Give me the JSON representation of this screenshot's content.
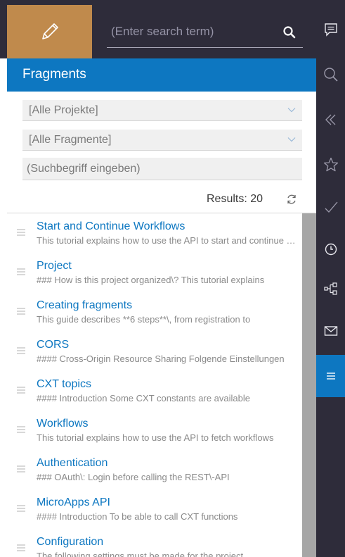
{
  "search": {
    "placeholder": "(Enter search term)"
  },
  "panel": {
    "title": "Fragments",
    "project_select": "[Alle Projekte]",
    "fragment_select": "[Alle Fragmente]",
    "search_placeholder": "(Suchbegriff eingeben)",
    "results_label": "Results: 20"
  },
  "list": [
    {
      "title": "Start and Continue Workflows",
      "desc": "This tutorial explains how to use the API to start and continue workflows"
    },
    {
      "title": "Project",
      "desc": "### How is this project organized\\? This tutorial explains"
    },
    {
      "title": "Creating fragments",
      "desc": "This guide describes **6 steps**\\, from registration to"
    },
    {
      "title": "CORS",
      "desc": "#### Cross-Origin Resource Sharing Folgende Einstellungen"
    },
    {
      "title": "CXT topics",
      "desc": "#### Introduction Some CXT constants are available"
    },
    {
      "title": "Workflows",
      "desc": "This tutorial explains how to use the API to fetch workflows"
    },
    {
      "title": "Authentication",
      "desc": "### OAuth\\: Login before calling the REST\\-API"
    },
    {
      "title": "MicroApps API",
      "desc": "#### Introduction To be able to call CXT functions"
    },
    {
      "title": "Configuration",
      "desc": "The following settings must be made for the project"
    }
  ],
  "icons": {
    "edit": "pencil-icon",
    "search": "search-icon",
    "rail": [
      "chat-icon",
      "search-icon",
      "collapse-icon",
      "star-icon",
      "check-icon",
      "clock-icon",
      "sitemap-icon",
      "mail-icon",
      "list-icon"
    ]
  },
  "colors": {
    "dark": "#2e2c3a",
    "accent": "#0d77c1",
    "edit": "#c08a4c"
  }
}
